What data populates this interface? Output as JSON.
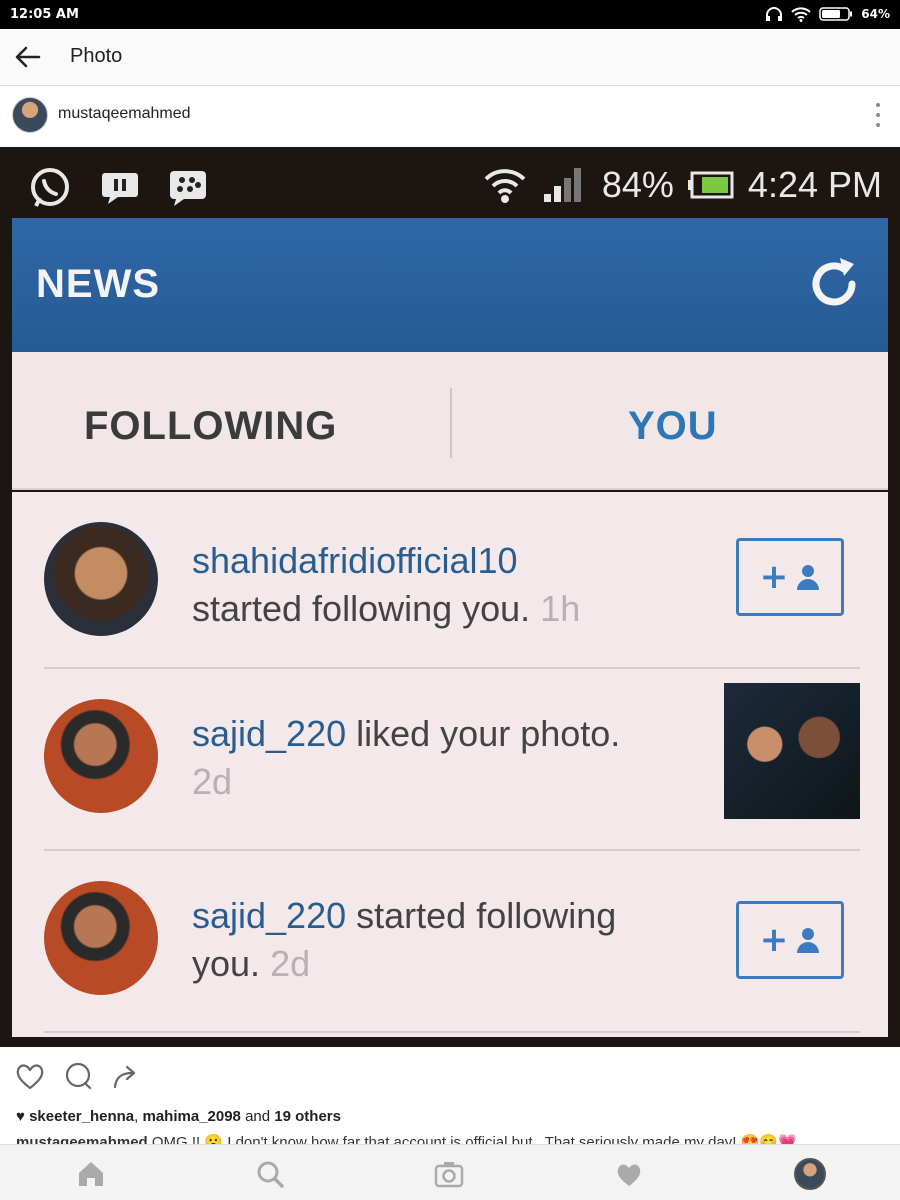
{
  "status_bar": {
    "time": "12:05 AM",
    "battery": "64%"
  },
  "app_bar": {
    "title": "Photo"
  },
  "post": {
    "username": "mustaqeemahmed"
  },
  "photo": {
    "status": {
      "battery": "84%",
      "time": "4:24 PM"
    },
    "header": {
      "label": "NEWS"
    },
    "tabs": {
      "following": "FOLLOWING",
      "you": "YOU"
    },
    "items": [
      {
        "user": "shahidafridiofficial10",
        "text": "started following you.",
        "time": "1h"
      },
      {
        "user": "sajid_220",
        "text": "liked your photo.",
        "time": "2d"
      },
      {
        "user": "sajid_220",
        "text": "started following",
        "text2": "you.",
        "time": "2d"
      }
    ]
  },
  "likes": {
    "user1": "skeeter_henna",
    "sep": ",",
    "user2": "mahima_2098",
    "and": "and",
    "others": "19 others"
  },
  "caption": {
    "user": "mustaqeemahmed",
    "text": "OMG !! 😮 I don't know how far that account is official but.. That seriously made my day! 😍😊💗"
  }
}
